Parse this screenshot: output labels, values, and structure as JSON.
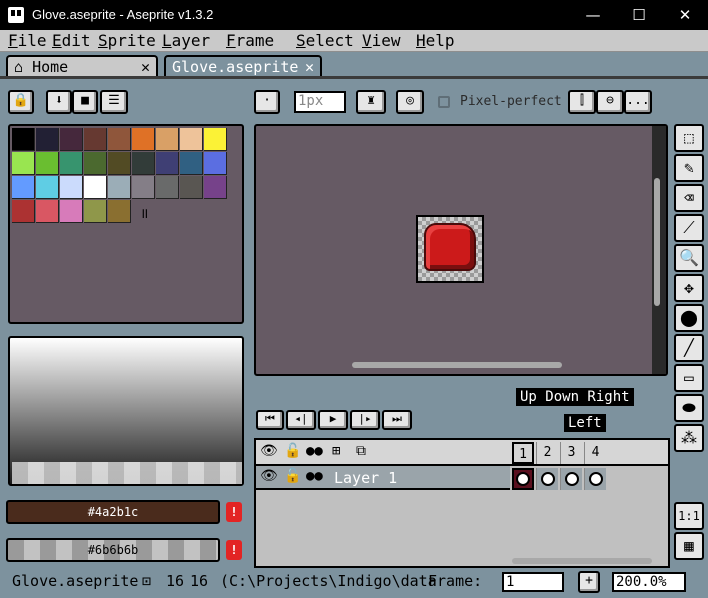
{
  "window": {
    "title": "Glove.aseprite - Aseprite v1.3.2",
    "minimize": "—",
    "maximize": "☐",
    "close": "✕"
  },
  "menu": [
    "File",
    "Edit",
    "Sprite",
    "Layer",
    "Frame",
    "Select",
    "View",
    "Help"
  ],
  "tabs": [
    {
      "label": "Home",
      "close": "✕"
    },
    {
      "label": "Glove.aseprite",
      "close": "✕"
    }
  ],
  "toolbar_left": {
    "lock": "🔒",
    "down": "⬇",
    "square": "■",
    "menu": "☰"
  },
  "toolbar_top": {
    "brush_size": "1px",
    "pixel_perfect": "Pixel-perfect",
    "more": "..."
  },
  "palette": {
    "colors": [
      "#000000",
      "#222034",
      "#45283c",
      "#663931",
      "#8f563b",
      "#df7126",
      "#d9a066",
      "#eec39a",
      "#fbf236",
      "#99e550",
      "#6abe30",
      "#37946e",
      "#4b692f",
      "#524b24",
      "#323c39",
      "#3f3f74",
      "#306082",
      "#5b6ee1",
      "#639bff",
      "#5fcde4",
      "#cbdbfc",
      "#ffffff",
      "#9badb7",
      "#847e87",
      "#696a6a",
      "#595652",
      "#76428a",
      "#ac3232",
      "#d95763",
      "#d77bba",
      "#8f974a",
      "#8a6f30"
    ],
    "columns": 9
  },
  "fg_color": {
    "hex": "#4a2b1c",
    "label": "#4a2b1c"
  },
  "bg_color": {
    "hex": "#6b6b6b",
    "label": "#6b6b6b"
  },
  "warning_symbol": "!",
  "timeline": {
    "tags": [
      "Up Down Right",
      "Left"
    ],
    "frames": [
      "1",
      "2",
      "3",
      "4"
    ],
    "layer_name": "Layer 1"
  },
  "tools_rail": [
    "marquee",
    "pencil",
    "eraser",
    "eyedropper",
    "zoom",
    "move",
    "fill",
    "line",
    "rectangle",
    "blob",
    "spray"
  ],
  "bottom_rail": {
    "ratio": "1:1",
    "film": "▦"
  },
  "status": {
    "file": "Glove.aseprite",
    "size_w": "16",
    "size_h": "16",
    "path": "(C:\\Projects\\Indigo\\data",
    "frame_label": "Frame:",
    "frame_value": "1",
    "plus": "+",
    "zoom": "200.0%"
  }
}
